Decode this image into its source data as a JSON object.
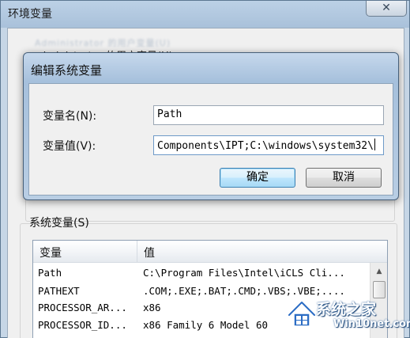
{
  "env_window": {
    "title": "环境变量",
    "close_glyph": "✕",
    "obscured_text": "Administrator 的用户变量(U)",
    "user_vars_caption": "administrator 的用户变量(U)",
    "system_vars_label": "系统变量(S)"
  },
  "edit_dialog": {
    "title": "编辑系统变量",
    "name_label": "变量名(N):",
    "name_value": "Path",
    "value_label": "变量值(V):",
    "value_value": "Components\\IPT;C:\\windows\\system32\\",
    "ok_label": "确定",
    "cancel_label": "取消"
  },
  "system_vars": {
    "columns": [
      "变量",
      "值"
    ],
    "rows": [
      {
        "name": "Path",
        "value": "C:\\Program Files\\Intel\\iCLS Cli..."
      },
      {
        "name": "PATHEXT",
        "value": ".COM;.EXE;.BAT;.CMD;.VBS;.VBE;...."
      },
      {
        "name": "PROCESSOR_AR...",
        "value": "x86"
      },
      {
        "name": "PROCESSOR_ID...",
        "value": "x86 Family 6 Model 60"
      }
    ]
  },
  "watermark": {
    "cn": "系统之家",
    "en": "Win10net.com"
  },
  "colors": {
    "title_bar": "#a9c1da",
    "default_button": "#bee6fd",
    "watermark_blue": "#2b6cc4"
  }
}
